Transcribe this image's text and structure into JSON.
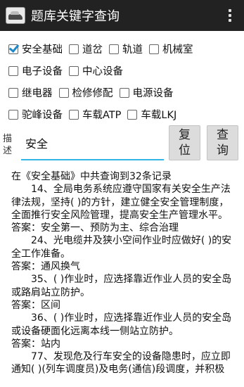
{
  "app": {
    "title": "题库关键字查询",
    "icon": "train-icon"
  },
  "checkboxes": [
    [
      {
        "label": "安全基础",
        "checked": true
      },
      {
        "label": "道岔",
        "checked": false
      },
      {
        "label": "轨道",
        "checked": false
      },
      {
        "label": "机械室",
        "checked": false
      }
    ],
    [
      {
        "label": "电子设备",
        "checked": false
      },
      {
        "label": "中心设备",
        "checked": false
      }
    ],
    [
      {
        "label": "继电器",
        "checked": false
      },
      {
        "label": "检修修配",
        "checked": false
      },
      {
        "label": "电源设备",
        "checked": false
      }
    ],
    [
      {
        "label": "驼峰设备",
        "checked": false
      },
      {
        "label": "车载ATP",
        "checked": false
      },
      {
        "label": "车载LKJ",
        "checked": false
      }
    ]
  ],
  "search": {
    "label": "描述",
    "value": "安全",
    "reset_label": "复位",
    "search_label": "查询"
  },
  "results": {
    "summary": "在《安全基础》中共查询到32条记录",
    "items": [
      {
        "q": "14、全局电务系统应遵守国家有关安全生产法律法规，坚持(    )的方针，建立健全安全管理制度，全面推行安全风险管理，提高安全生产管理水平。",
        "a": "答案：安全第一、预防为主、综合治理"
      },
      {
        "q": "24、光电缆井及狭小空间作业时应做好(    )的安全工作准备。",
        "a": "答案：通风换气"
      },
      {
        "q": "35、(    )作业时，应选择靠近作业人员的安全岛或路肩站立防护。",
        "a": "答案：区间"
      },
      {
        "q": "36、(    )作业时，应选择靠近作业人员的安全岛或设备硬面化远离本线一侧站立防护。",
        "a": "答案：站内"
      },
      {
        "q": "77、发现危及行车安全的设备隐患时，应立即通知(    )(列车调度员)及电务(通信)段调度，并积极",
        "a": ""
      }
    ]
  }
}
